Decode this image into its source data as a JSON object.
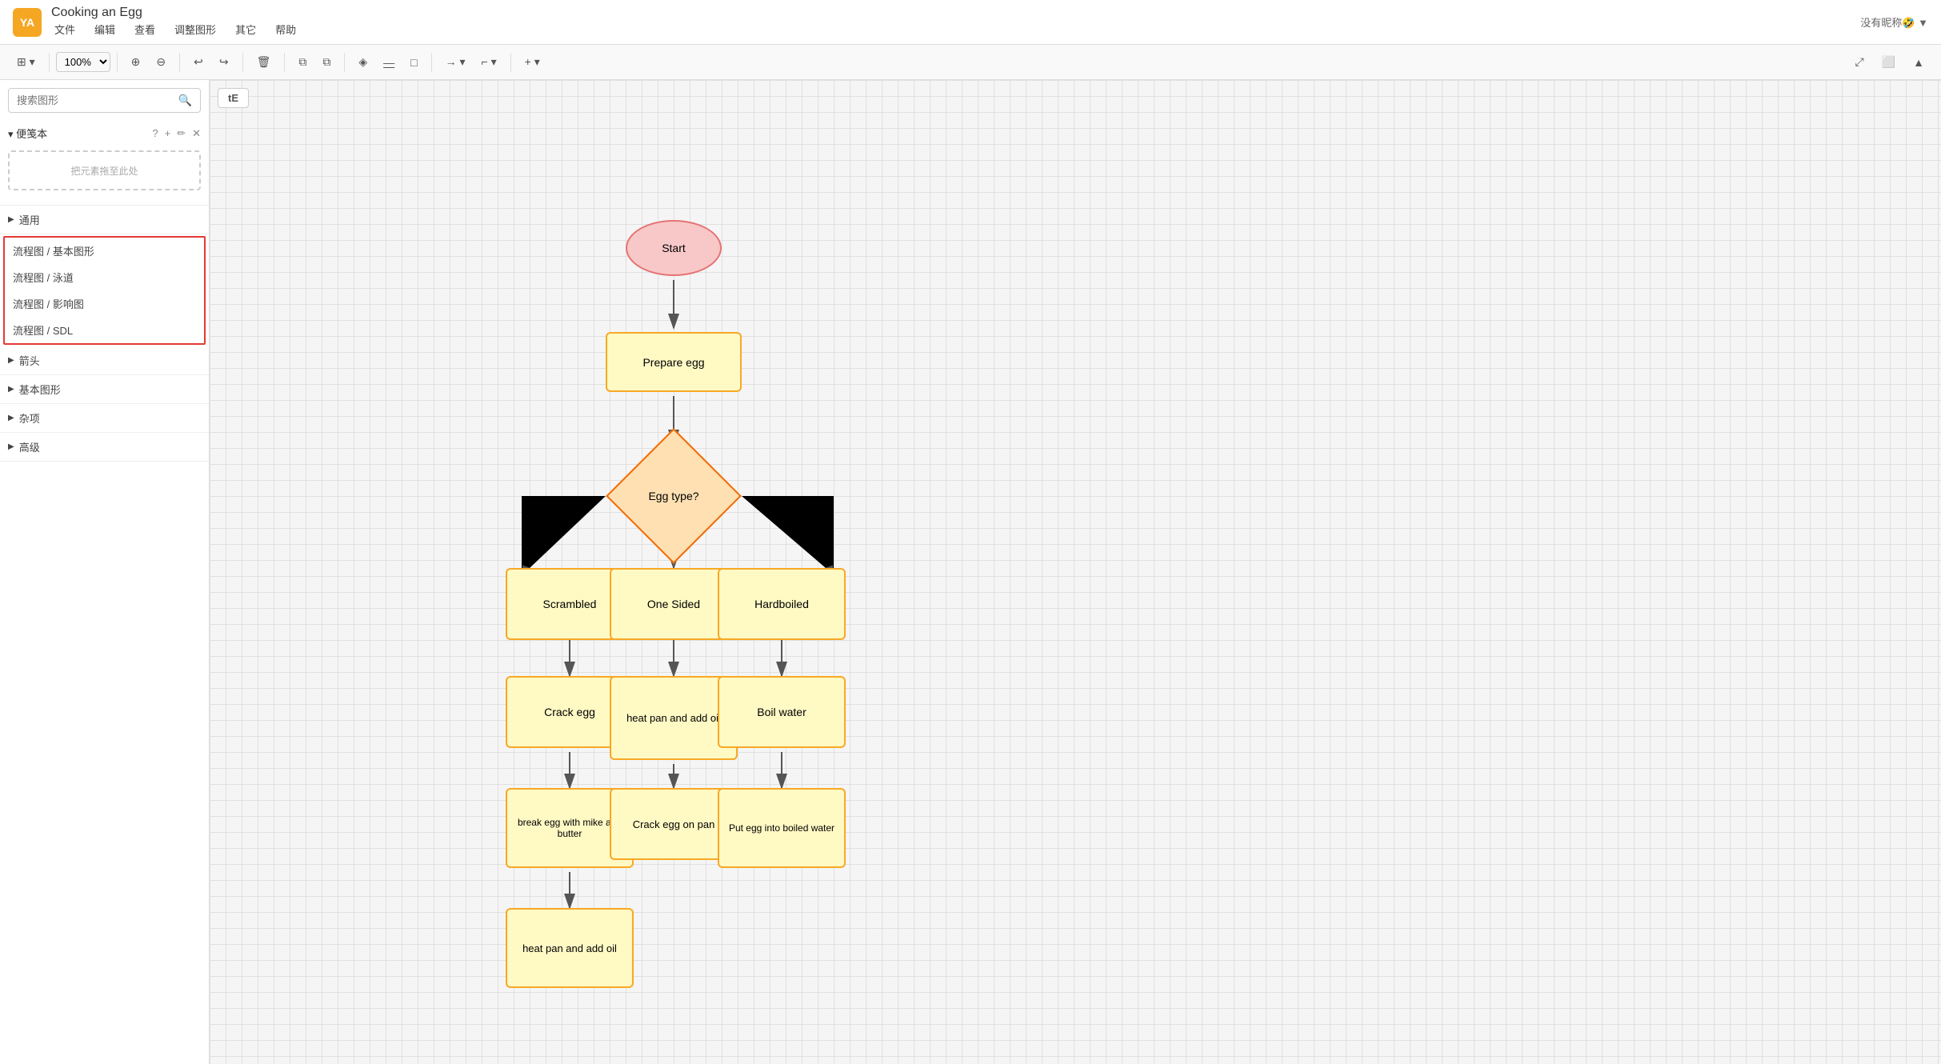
{
  "app": {
    "logo": "YA",
    "title": "Cooking an Egg",
    "menu": [
      "文件",
      "编辑",
      "查看",
      "调整图形",
      "其它",
      "帮助"
    ],
    "user": "没有昵称🤣 ▼"
  },
  "toolbar": {
    "zoom": "100%",
    "undo_icon": "↩",
    "redo_icon": "↪",
    "delete_icon": "🗑",
    "copy_icon": "⧉",
    "paste_icon": "⧉",
    "fill_icon": "◈",
    "line_icon": "—",
    "rect_icon": "□",
    "arrow_icon": "→",
    "corner_icon": "⌐",
    "add_icon": "+",
    "expand_icon": "⤢",
    "fullscreen_icon": "⬜"
  },
  "sidebar": {
    "search_placeholder": "搜索图形",
    "notepad_label": "▾ 便笺本",
    "notepad_icons": [
      "?",
      "+",
      "✏",
      "✕"
    ],
    "notepad_drop": "把元素拖至此处",
    "groups": [
      {
        "label": "通用",
        "expanded": false,
        "items": []
      },
      {
        "label": "流程图 / 基本图形",
        "expanded": true,
        "items": [],
        "highlighted": true
      },
      {
        "label": "流程图 / 泳道",
        "expanded": true,
        "items": [],
        "highlighted": true
      },
      {
        "label": "流程图 / 影响图",
        "expanded": true,
        "items": [],
        "highlighted": true
      },
      {
        "label": "流程图 / SDL",
        "expanded": true,
        "items": [],
        "highlighted": true
      },
      {
        "label": "箭头",
        "expanded": false,
        "items": []
      },
      {
        "label": "基本图形",
        "expanded": false,
        "items": []
      },
      {
        "label": "杂项",
        "expanded": false,
        "items": []
      },
      {
        "label": "高级",
        "expanded": false,
        "items": []
      }
    ]
  },
  "tab_indicator": "tE",
  "flowchart": {
    "nodes": {
      "start": {
        "label": "Start",
        "type": "oval"
      },
      "prepare": {
        "label": "Prepare egg",
        "type": "rect"
      },
      "egg_type": {
        "label": "Egg type?",
        "type": "diamond"
      },
      "scrambled": {
        "label": "Scrambled",
        "type": "rect"
      },
      "one_sided": {
        "label": "One Sided",
        "type": "rect"
      },
      "hardboiled": {
        "label": "Hardboiled",
        "type": "rect"
      },
      "crack_egg": {
        "label": "Crack egg",
        "type": "rect"
      },
      "heat_pan_1": {
        "label": "heat pan and add oil",
        "type": "rect"
      },
      "boil_water": {
        "label": "Boil water",
        "type": "rect"
      },
      "break_egg": {
        "label": "break egg with mike and butter",
        "type": "rect"
      },
      "crack_pan": {
        "label": "Crack egg on pan",
        "type": "rect"
      },
      "put_egg": {
        "label": "Put egg into boiled water",
        "type": "rect"
      },
      "heat_pan_2": {
        "label": "heat pan and add oil",
        "type": "rect"
      }
    }
  }
}
